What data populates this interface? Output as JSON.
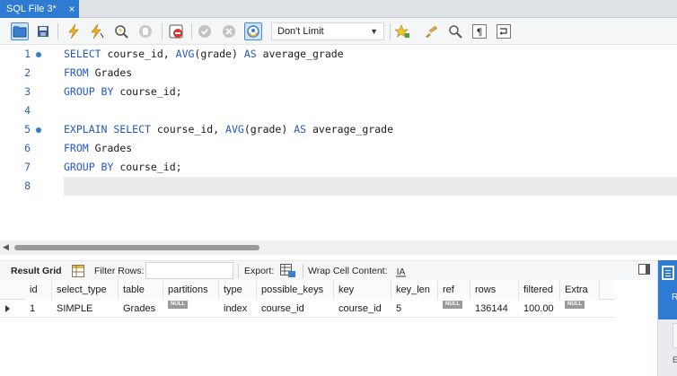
{
  "tab": {
    "title": "SQL File 3*",
    "close": "×"
  },
  "toolbar": {
    "limit_value": "Don't Limit"
  },
  "editor": {
    "lines": [
      {
        "num": "1",
        "marker": true,
        "tokens": [
          {
            "t": "SELECT",
            "kw": true
          },
          {
            "t": " course_id, "
          },
          {
            "t": "AVG",
            "kw": true
          },
          {
            "t": "(grade) "
          },
          {
            "t": "AS",
            "kw": true
          },
          {
            "t": " average_grade"
          }
        ]
      },
      {
        "num": "2",
        "marker": false,
        "tokens": [
          {
            "t": "FROM",
            "kw": true
          },
          {
            "t": " Grades"
          }
        ]
      },
      {
        "num": "3",
        "marker": false,
        "tokens": [
          {
            "t": "GROUP BY",
            "kw": true
          },
          {
            "t": " course_id;"
          }
        ]
      },
      {
        "num": "4",
        "marker": false,
        "tokens": []
      },
      {
        "num": "5",
        "marker": true,
        "tokens": [
          {
            "t": "EXPLAIN SELECT",
            "kw": true
          },
          {
            "t": " course_id, "
          },
          {
            "t": "AVG",
            "kw": true
          },
          {
            "t": "(grade) "
          },
          {
            "t": "AS",
            "kw": true
          },
          {
            "t": " average_grade"
          }
        ]
      },
      {
        "num": "6",
        "marker": false,
        "tokens": [
          {
            "t": "FROM",
            "kw": true
          },
          {
            "t": " Grades"
          }
        ]
      },
      {
        "num": "7",
        "marker": false,
        "tokens": [
          {
            "t": "GROUP BY",
            "kw": true
          },
          {
            "t": " course_id;"
          }
        ]
      },
      {
        "num": "8",
        "marker": false,
        "tokens": []
      }
    ]
  },
  "results_toolbar": {
    "result_grid": "Result Grid",
    "filter_rows": "Filter Rows:",
    "export": "Export:",
    "wrap_cell": "Wrap Cell Content:"
  },
  "grid": {
    "columns": [
      "id",
      "select_type",
      "table",
      "partitions",
      "type",
      "possible_keys",
      "key",
      "key_len",
      "ref",
      "rows",
      "filtered",
      "Extra"
    ],
    "null_label": "NULL",
    "rows": [
      [
        "1",
        "SIMPLE",
        "Grades",
        null,
        "index",
        "course_id",
        "course_id",
        "5",
        null,
        "136144",
        "100.00",
        null
      ]
    ]
  },
  "side_panel": {
    "label_1": "R",
    "label_2": "E"
  }
}
